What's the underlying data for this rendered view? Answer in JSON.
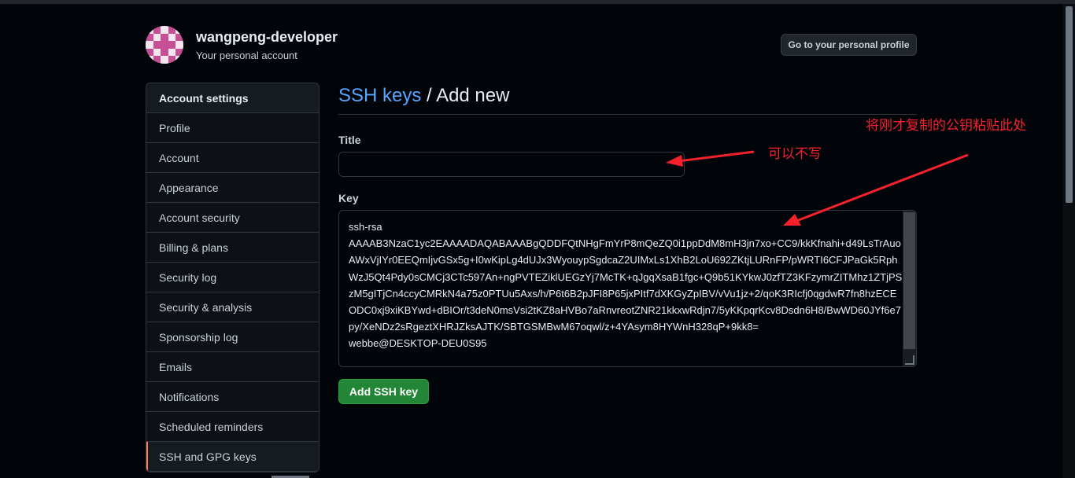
{
  "account": {
    "username": "wangpeng-developer",
    "subtitle": "Your personal account",
    "profile_button": "Go to your personal profile"
  },
  "sidebar": {
    "header": "Account settings",
    "items": [
      {
        "label": "Profile"
      },
      {
        "label": "Account"
      },
      {
        "label": "Appearance"
      },
      {
        "label": "Account security"
      },
      {
        "label": "Billing & plans"
      },
      {
        "label": "Security log"
      },
      {
        "label": "Security & analysis"
      },
      {
        "label": "Sponsorship log"
      },
      {
        "label": "Emails"
      },
      {
        "label": "Notifications"
      },
      {
        "label": "Scheduled reminders"
      },
      {
        "label": "SSH and GPG keys"
      }
    ],
    "selected": "SSH and GPG keys"
  },
  "main": {
    "breadcrumb_link": "SSH keys",
    "breadcrumb_sep": " / ",
    "breadcrumb_current": "Add new",
    "title_label": "Title",
    "title_value": "",
    "key_label": "Key",
    "key_value": "ssh-rsa\nAAAAB3NzaC1yc2EAAAADAQABAAABgQDDFQtNHgFmYrP8mQeZQ0i1ppDdM8mH3jn7xo+CC9/kkKfnahi+d49LsTrAuoAWxVjIYr0EEQmIjvGSx5g+I0wKipLg4dUJx3WyouypSgdcaZ2UIMxLs1XhB2LoU692ZKtjLURnFP/pWRTI6CFJPaGk5RphWzJ5Qt4Pdy0sCMCj3CTc597An+ngPVTEZiklUEGzYj7McTK+qJgqXsaB1fgc+Q9b51KYkwJ0zfTZ3KFzymrZITMhz1ZTjPSzM5gITjCn4ccyCMRkN4a75z0PTUu5Axs/h/P6t6B2pJFI8P65jxPItf7dXKGyZpIBV/vVu1jz+2/qoK3RIcfj0qgdwR7fn8hzECEODC0xj9xiKBYwd+dBIOr/t3deN0msVsi2tKZ8aHVBo7aRnvreotZNR21kkxwRdjn7/5yKKpqrKcv8Dsdn6H8/BwWD60JYf6e7py/XeNDz2sRgeztXHRJZksAJTK/SBTGSMBwM67oqwl/z+4YAsym8HYWnH328qP+9kk8=\nwebbe@DESKTOP-DEU0S95",
    "submit_button": "Add SSH key"
  },
  "annotations": {
    "optional_note": "可以不写",
    "paste_note": "将刚才复制的公钥粘贴此处",
    "color": "#f5222d"
  },
  "colors": {
    "background": "#010409",
    "link": "#58a6ff",
    "primary_button": "#238636",
    "selected_accent": "#f78166"
  }
}
